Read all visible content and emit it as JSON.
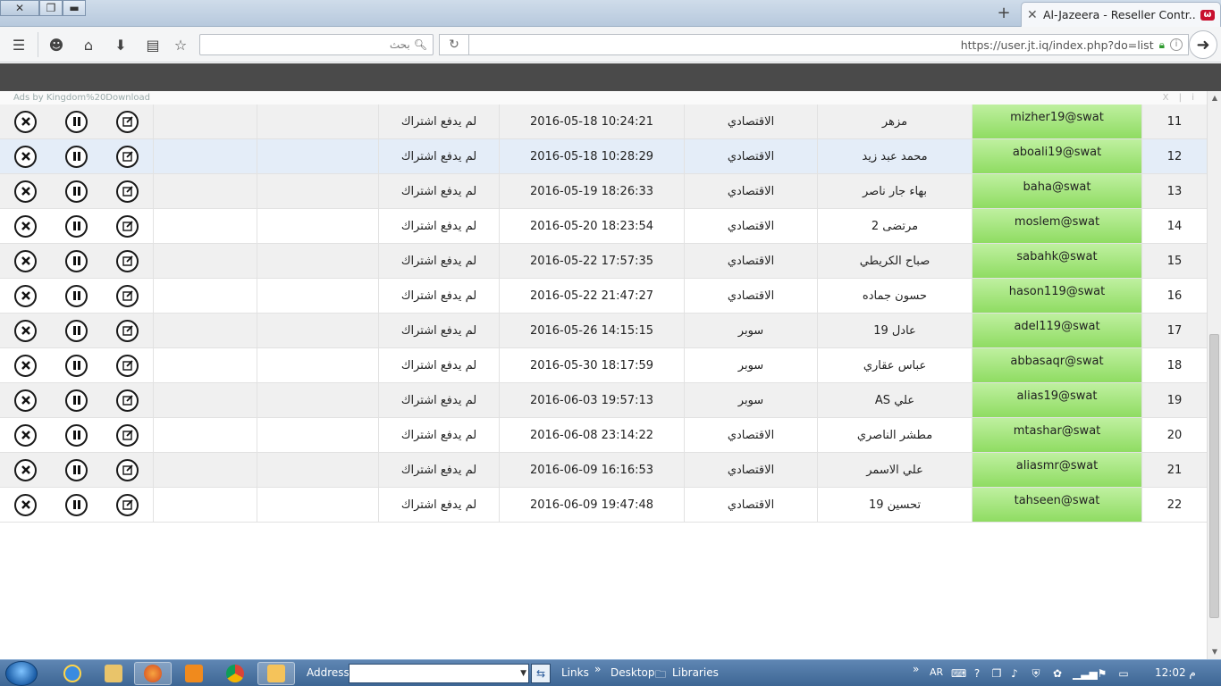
{
  "browser": {
    "tab_title": "Al-Jazeera - Reseller Contr...",
    "tab_close": "✕",
    "new_tab": "+",
    "search_placeholder": "بحث",
    "url": "https://user.jt.iq/index.php?do=list"
  },
  "ad_bar": {
    "label": "Ads by Kingdom%20Download",
    "controls": "X | i"
  },
  "rows": [
    {
      "num": "11",
      "username": "mizher19@swat",
      "name": "مزهر",
      "package": "الاقتصادي",
      "date": "2016-05-18 10:24:21",
      "status": "لم يدفع اشتراك"
    },
    {
      "num": "12",
      "username": "aboali19@swat",
      "name": "محمد عبد زيد",
      "package": "الاقتصادي",
      "date": "2016-05-18 10:28:29",
      "status": "لم يدفع اشتراك"
    },
    {
      "num": "13",
      "username": "baha@swat",
      "name": "بهاء جار ناصر",
      "package": "الاقتصادي",
      "date": "2016-05-19 18:26:33",
      "status": "لم يدفع اشتراك"
    },
    {
      "num": "14",
      "username": "moslem@swat",
      "name": "مرتضى 2",
      "package": "الاقتصادي",
      "date": "2016-05-20 18:23:54",
      "status": "لم يدفع اشتراك"
    },
    {
      "num": "15",
      "username": "sabahk@swat",
      "name": "صباح الكريطي",
      "package": "الاقتصادي",
      "date": "2016-05-22 17:57:35",
      "status": "لم يدفع اشتراك"
    },
    {
      "num": "16",
      "username": "hason119@swat",
      "name": "حسون جماده",
      "package": "الاقتصادي",
      "date": "2016-05-22 21:47:27",
      "status": "لم يدفع اشتراك"
    },
    {
      "num": "17",
      "username": "adel119@swat",
      "name": "عادل 19",
      "package": "سوبر",
      "date": "2016-05-26 14:15:15",
      "status": "لم يدفع اشتراك"
    },
    {
      "num": "18",
      "username": "abbasaqr@swat",
      "name": "عباس عقاري",
      "package": "سوبر",
      "date": "2016-05-30 18:17:59",
      "status": "لم يدفع اشتراك"
    },
    {
      "num": "19",
      "username": "alias19@swat",
      "name": "علي AS",
      "package": "سوبر",
      "date": "2016-06-03 19:57:13",
      "status": "لم يدفع اشتراك"
    },
    {
      "num": "20",
      "username": "mtashar@swat",
      "name": "مطشر الناصري",
      "package": "الاقتصادي",
      "date": "2016-06-08 23:14:22",
      "status": "لم يدفع اشتراك"
    },
    {
      "num": "21",
      "username": "aliasmr@swat",
      "name": "علي الاسمر",
      "package": "الاقتصادي",
      "date": "2016-06-09 16:16:53",
      "status": "لم يدفع اشتراك"
    },
    {
      "num": "22",
      "username": "tahseen@swat",
      "name": "تحسين 19",
      "package": "الاقتصادي",
      "date": "2016-06-09 19:47:48",
      "status": "لم يدفع اشتراك"
    }
  ],
  "taskbar": {
    "address_label": "Address",
    "links_label": "Links",
    "desktop_label": "Desktop",
    "libraries_label": "Libraries",
    "lang": "AR",
    "clock": "12:02 م",
    "overflow": "»"
  }
}
